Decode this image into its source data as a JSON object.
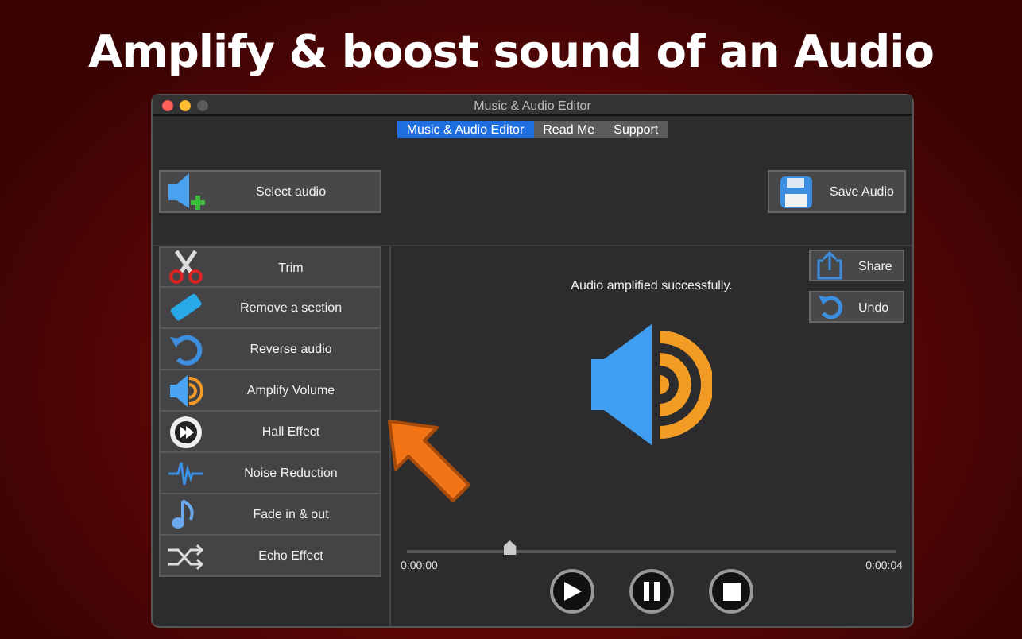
{
  "headline": "Amplify & boost sound of an Audio",
  "window": {
    "title": "Music & Audio Editor"
  },
  "tabs": [
    {
      "label": "Music & Audio Editor",
      "selected": true
    },
    {
      "label": "Read Me",
      "selected": false
    },
    {
      "label": "Support",
      "selected": false
    }
  ],
  "toolbar": {
    "select_button": "Select audio",
    "save_button": "Save Audio"
  },
  "tools": [
    {
      "label": "Trim"
    },
    {
      "label": "Remove a section"
    },
    {
      "label": "Reverse audio"
    },
    {
      "label": "Amplify Volume"
    },
    {
      "label": "Hall Effect"
    },
    {
      "label": "Noise Reduction"
    },
    {
      "label": "Fade in & out"
    },
    {
      "label": "Echo Effect"
    }
  ],
  "side_buttons": [
    "Share",
    "Undo"
  ],
  "status": "Audio amplified successfully.",
  "player": {
    "level": 0.21,
    "start_time": "0:00:00",
    "end_time": "0:00:04"
  }
}
